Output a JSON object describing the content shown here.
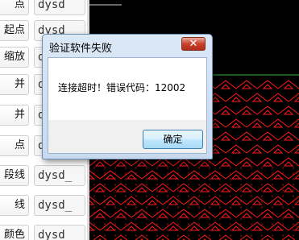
{
  "panel": {
    "rows": [
      {
        "label": "点",
        "value": "dysd"
      },
      {
        "label": "起点",
        "value": "dysd"
      },
      {
        "label": "缩放",
        "value": "dysd"
      },
      {
        "label": "并",
        "value": "d"
      },
      {
        "label": "并",
        "value": "d"
      },
      {
        "label": "点",
        "value": "d"
      },
      {
        "label": "段线",
        "value": "dysd_"
      },
      {
        "label": "线",
        "value": "dysd_"
      },
      {
        "label": "颜色",
        "value": "dysd"
      }
    ]
  },
  "dialog": {
    "title": "验证软件失败",
    "close_glyph": "✕",
    "message": "连接超时！错误代码：12002",
    "ok_label": "确定"
  },
  "colors": {
    "canvas_bg": "#000000",
    "pattern": "#ff1a1a",
    "guide_line": "#3cb043"
  }
}
